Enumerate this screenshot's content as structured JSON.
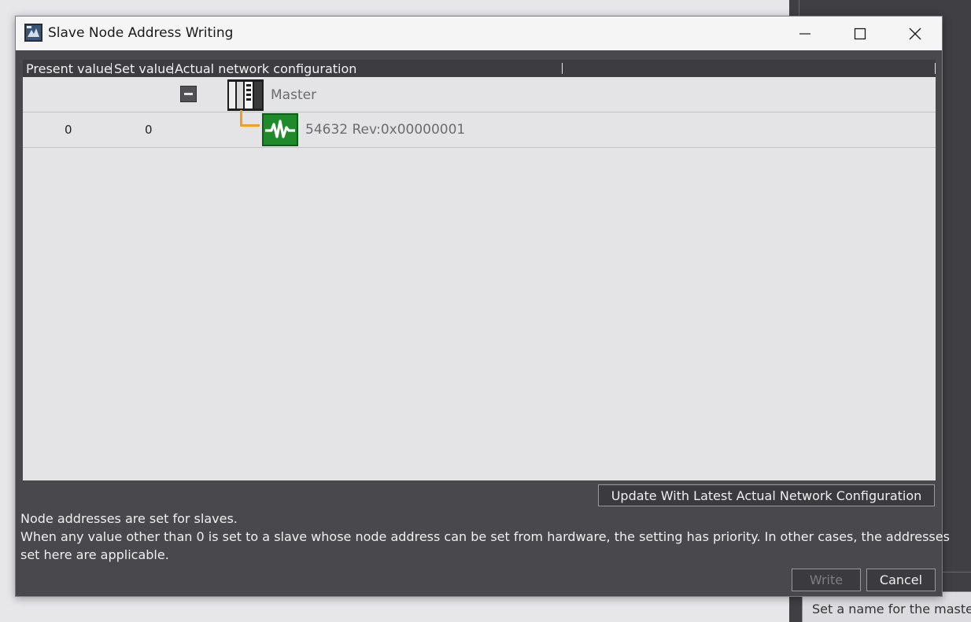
{
  "background": {
    "hint_text": "Set a name for the master"
  },
  "dialog": {
    "title": "Slave Node Address Writing",
    "columns": [
      "Present value",
      "Set value",
      "Actual network configuration"
    ],
    "rows": [
      {
        "present": "",
        "set": "",
        "label": "Master",
        "icon": "master-unit-icon"
      },
      {
        "present": "0",
        "set": "0",
        "label": "54632 Rev:0x00000001",
        "icon": "slave-device-icon"
      }
    ],
    "update_button": "Update With Latest Actual Network Configuration",
    "message_line1": "Node addresses are set for slaves.",
    "message_line2": "When any value other than 0 is set to a slave whose node address can be set from hardware, the setting has priority. In other cases, the addresses",
    "message_line3": "set here are applicable.",
    "write_button": "Write",
    "cancel_button": "Cancel"
  },
  "colors": {
    "dialog_bg": "#48484d",
    "grid_bg": "#e4e4e6",
    "connector": "#f0a020",
    "slave_icon": "#1f8a2a"
  }
}
